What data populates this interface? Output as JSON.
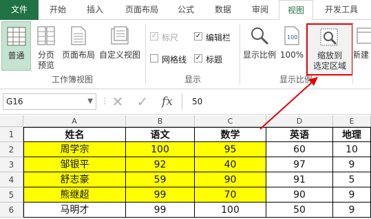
{
  "tabs": [
    "文件",
    "开始",
    "插入",
    "页面布局",
    "公式",
    "数据",
    "审阅",
    "视图",
    "开发工具"
  ],
  "active_tab": "视图",
  "ribbon": {
    "workbook_views": {
      "normal": "普通",
      "page_break_1": "分页",
      "page_break_2": "预览",
      "page_layout": "页面布局",
      "custom_views": "自定义视图",
      "group": "工作簿视图"
    },
    "show": {
      "ruler": "标尺",
      "formula_bar": "编辑栏",
      "gridlines": "网格线",
      "headings": "标题",
      "group": "显示"
    },
    "zoom": {
      "zoom": "显示比例",
      "zoom_100": "100%",
      "zoom_sel_1": "缩放到",
      "zoom_sel_2": "选定区域",
      "group": "显示比例"
    },
    "window": {
      "new_window": "新建"
    }
  },
  "formula_bar": {
    "name_box": "G16",
    "fx": "fx",
    "value": "50"
  },
  "sheet": {
    "columns": [
      "A",
      "B",
      "C",
      "D",
      "E"
    ],
    "row_numbers": [
      "1",
      "2",
      "3",
      "4",
      "5",
      "6"
    ],
    "rows": [
      [
        "姓名",
        "语文",
        "数学",
        "英语",
        "地理"
      ],
      [
        "周学宗",
        "100",
        "95",
        "60",
        "10"
      ],
      [
        "邹银平",
        "92",
        "40",
        "97",
        "9"
      ],
      [
        "舒志豪",
        "59",
        "90",
        "91",
        "5"
      ],
      [
        "熊继超",
        "99",
        "70",
        "90",
        "9"
      ],
      [
        "马明才",
        "99",
        "100",
        "50",
        "9"
      ]
    ]
  },
  "colors": {
    "accent": "#217346",
    "highlight": "#ffff00",
    "annotation": "#e60000"
  }
}
